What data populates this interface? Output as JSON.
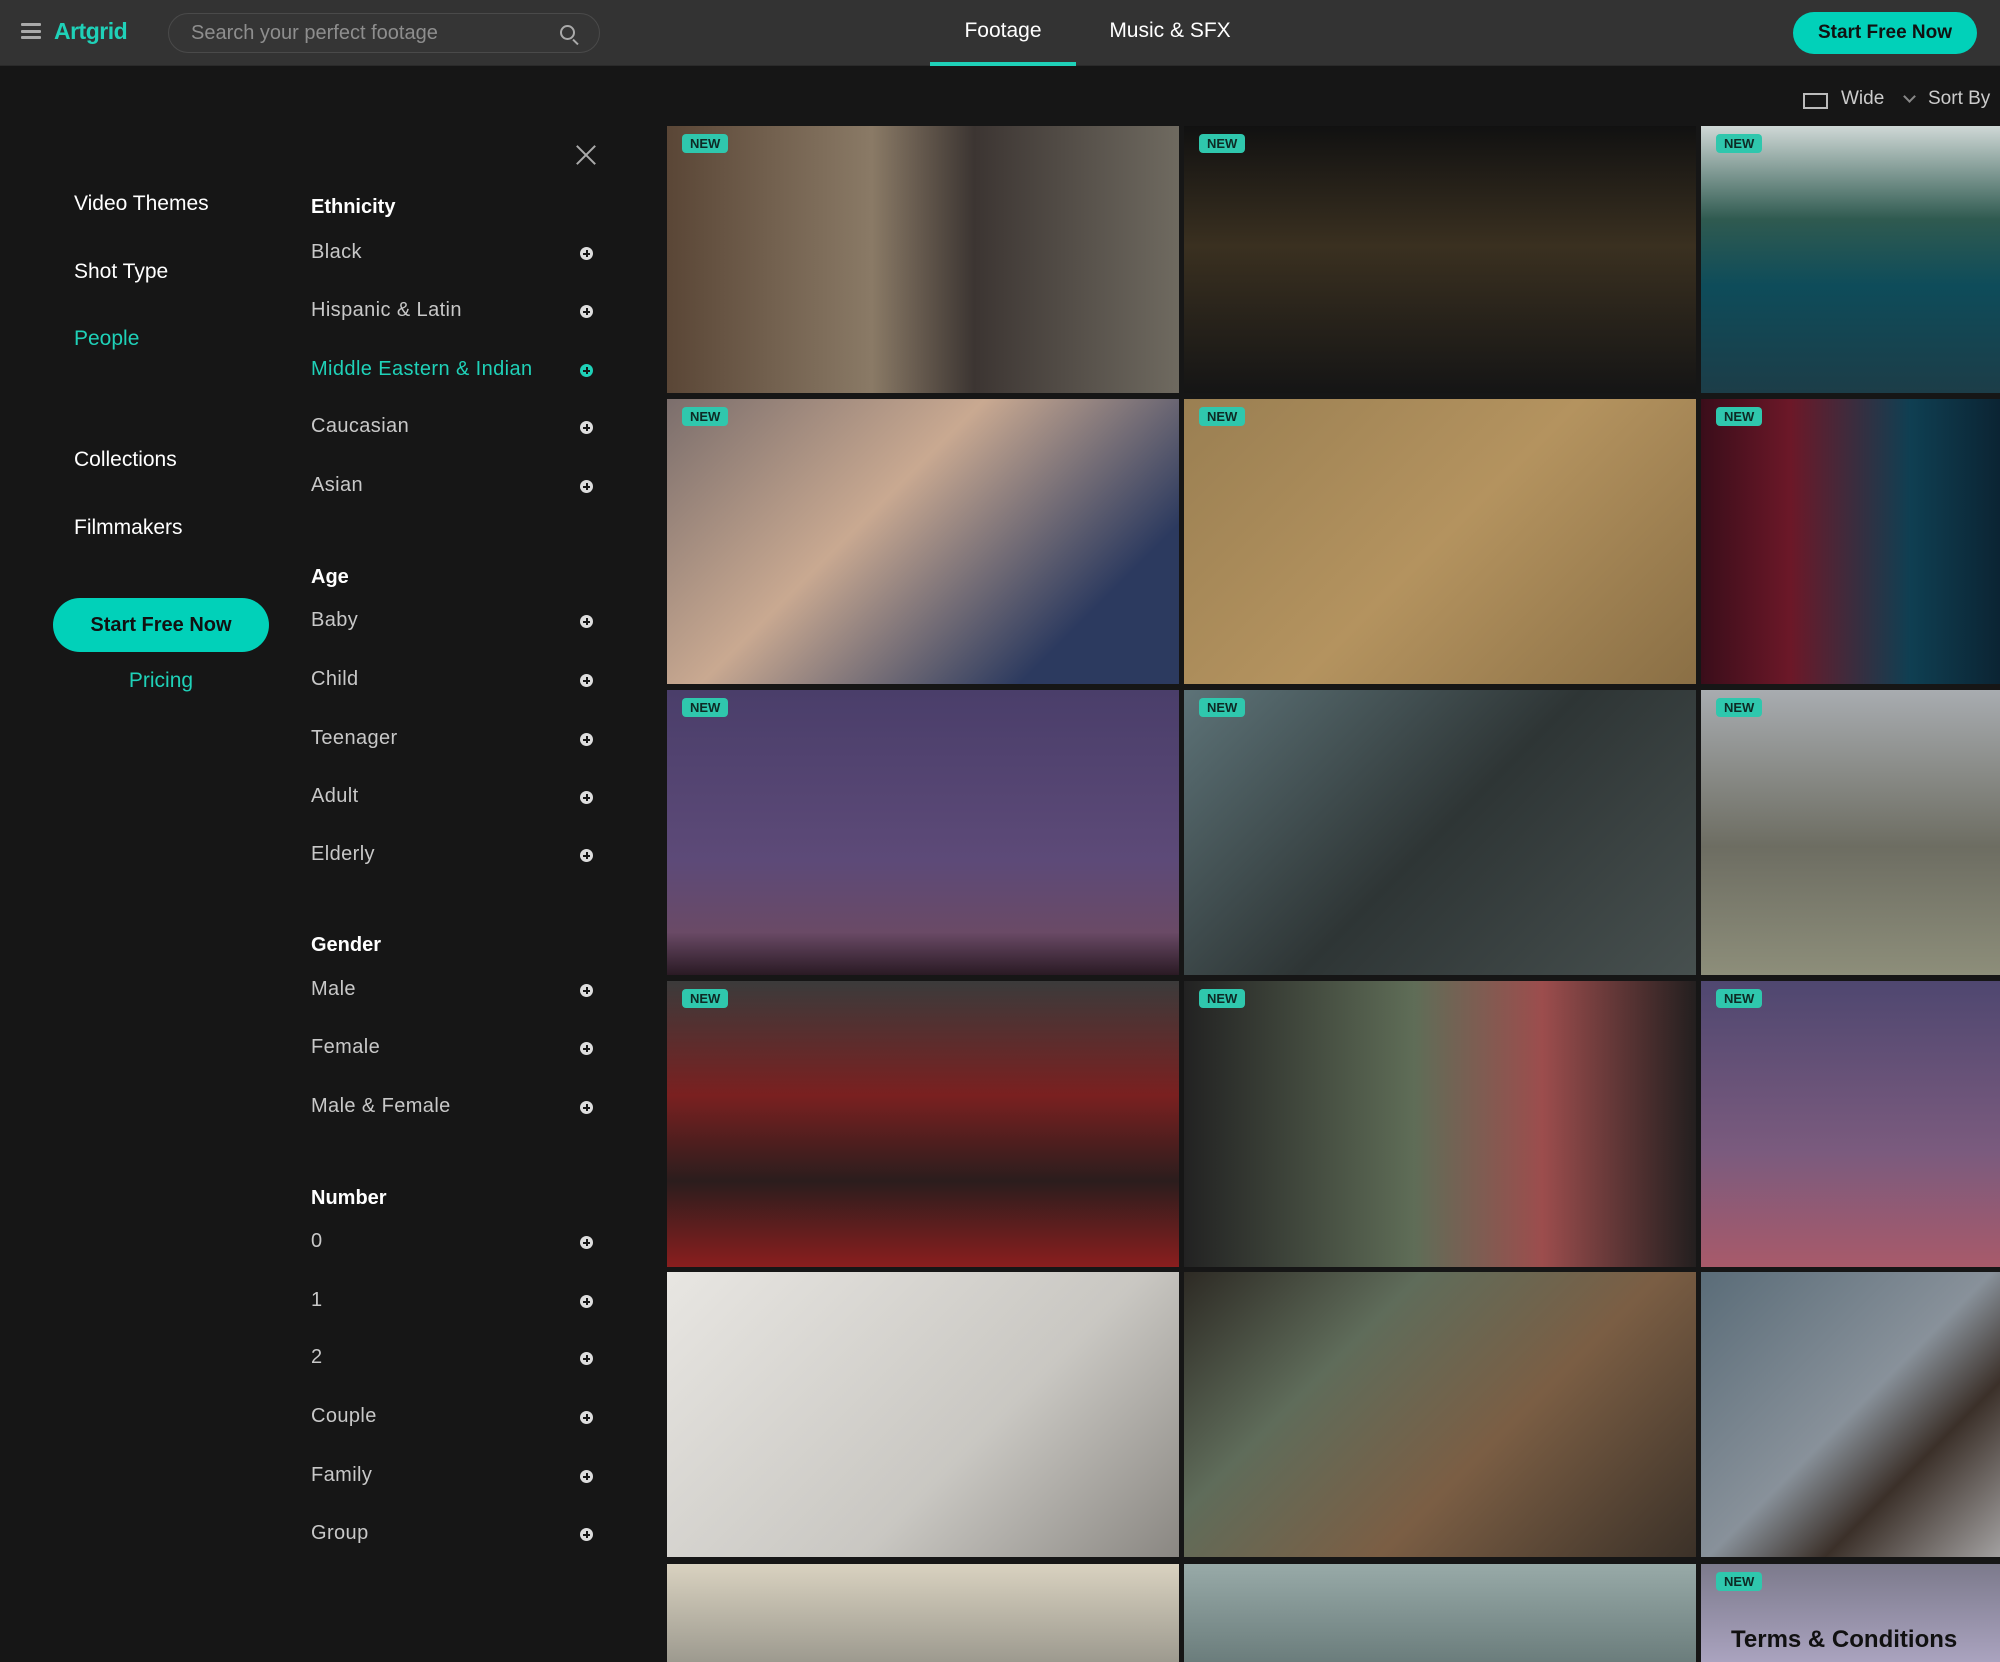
{
  "header": {
    "logo": "Artgrid",
    "search_placeholder": "Search your perfect footage",
    "tabs": [
      "Footage",
      "Music & SFX"
    ],
    "cta": "Start Free Now"
  },
  "toolbar": {
    "aspect": "Wide",
    "sort": "Sort By"
  },
  "sidebar": {
    "nav": [
      "Video Themes",
      "Shot Type",
      "People",
      "Collections",
      "Filmmakers"
    ],
    "active_nav": "People",
    "cta": "Start Free Now",
    "pricing": "Pricing"
  },
  "filters": [
    {
      "title": "Ethnicity",
      "items": [
        "Black",
        "Hispanic & Latin",
        "Middle Eastern & Indian",
        "Caucasian",
        "Asian"
      ],
      "active": "Middle Eastern & Indian"
    },
    {
      "title": "Age",
      "items": [
        "Baby",
        "Child",
        "Teenager",
        "Adult",
        "Elderly"
      ]
    },
    {
      "title": "Gender",
      "items": [
        "Male",
        "Female",
        "Male & Female"
      ]
    },
    {
      "title": "Number",
      "items": [
        "0",
        "1",
        "2",
        "Couple",
        "Family",
        "Group"
      ]
    }
  ],
  "grid": {
    "badge": "NEW",
    "new_flags": [
      true,
      true,
      true,
      true,
      true,
      true,
      true,
      true,
      true,
      true,
      true,
      true,
      false,
      false,
      false,
      false,
      false,
      true
    ],
    "last_thumb_text": "Terms & Conditions"
  }
}
